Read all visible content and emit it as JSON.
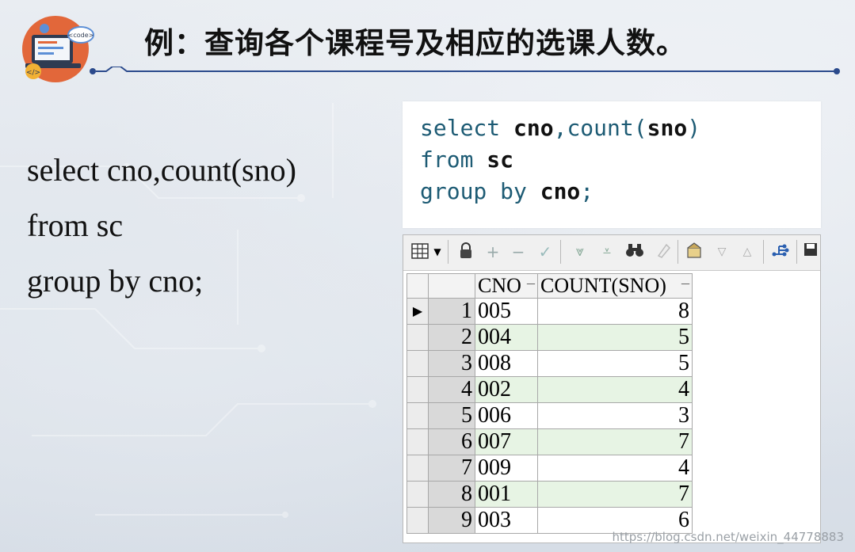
{
  "header": {
    "title": "例：查询各个课程号及相应的选课人数。"
  },
  "logo": {
    "badge_text": "<code>",
    "code_glyph": "</>"
  },
  "plain_sql": {
    "lines": [
      "select cno,count(sno)",
      "from sc",
      "group by cno;"
    ]
  },
  "code_panel": {
    "line1": {
      "kw": "select ",
      "a": "cno",
      "b": ",count(",
      "c": "sno",
      "d": ")"
    },
    "line2": {
      "kw": "from ",
      "a": "sc"
    },
    "line3": {
      "kw": "group by ",
      "a": "cno",
      "b": ";"
    }
  },
  "toolbar": {
    "icons": [
      "grid-icon",
      "dropdown-arrow-icon",
      "lock-icon",
      "add-record-icon",
      "delete-record-icon",
      "post-edit-icon",
      "filter-down-icon",
      "filter-clear-icon",
      "binoculars-icon",
      "clear-icon",
      "export-icon",
      "sort-down-icon",
      "sort-up-icon",
      "chart-icon",
      "save-icon"
    ]
  },
  "grid": {
    "columns": [
      "CNO",
      "COUNT(SNO)"
    ],
    "rows": [
      {
        "n": "1",
        "cno": "005",
        "count": "8"
      },
      {
        "n": "2",
        "cno": "004",
        "count": "5"
      },
      {
        "n": "3",
        "cno": "008",
        "count": "5"
      },
      {
        "n": "4",
        "cno": "002",
        "count": "4"
      },
      {
        "n": "5",
        "cno": "006",
        "count": "3"
      },
      {
        "n": "6",
        "cno": "007",
        "count": "7"
      },
      {
        "n": "7",
        "cno": "009",
        "count": "4"
      },
      {
        "n": "8",
        "cno": "001",
        "count": "7"
      },
      {
        "n": "9",
        "cno": "003",
        "count": "6"
      }
    ],
    "current_row_marker": "▶",
    "alt_row_color": "#e7f4e4"
  },
  "watermark": "https://blog.csdn.net/weixin_44778883",
  "colors": {
    "code_blue": "#1d5b74",
    "rule_blue": "#2b4a8c",
    "logo_orange": "#e2673a"
  }
}
